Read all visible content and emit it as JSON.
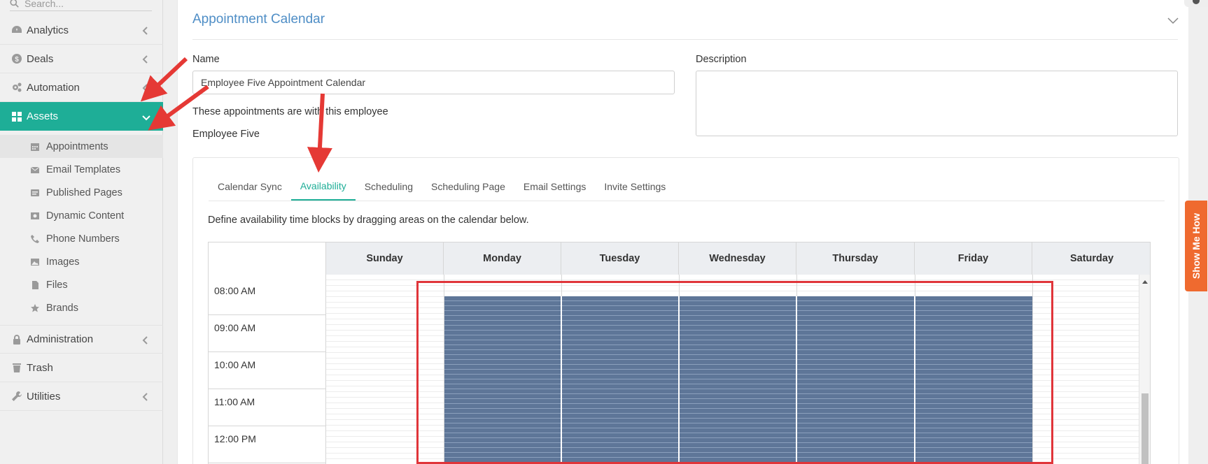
{
  "sidebar": {
    "search_placeholder": "Search...",
    "items": [
      {
        "label": "Analytics",
        "icon": "dashboard-icon"
      },
      {
        "label": "Deals",
        "icon": "dollar-icon"
      },
      {
        "label": "Automation",
        "icon": "cogs-icon"
      },
      {
        "label": "Assets",
        "icon": "grid-icon"
      },
      {
        "label": "Administration",
        "icon": "lock-icon"
      },
      {
        "label": "Trash",
        "icon": "trash-icon"
      },
      {
        "label": "Utilities",
        "icon": "wrench-icon"
      }
    ],
    "assets_submenu": [
      {
        "label": "Appointments",
        "icon": "calendar-icon"
      },
      {
        "label": "Email Templates",
        "icon": "envelope-icon"
      },
      {
        "label": "Published Pages",
        "icon": "page-icon"
      },
      {
        "label": "Dynamic Content",
        "icon": "dynamic-content-icon"
      },
      {
        "label": "Phone Numbers",
        "icon": "phone-icon"
      },
      {
        "label": "Images",
        "icon": "image-icon"
      },
      {
        "label": "Files",
        "icon": "file-icon"
      },
      {
        "label": "Brands",
        "icon": "star-icon"
      }
    ]
  },
  "panel": {
    "title": "Appointment Calendar",
    "name_label": "Name",
    "name_value": "Employee Five Appointment Calendar",
    "description_label": "Description",
    "employee_note": "These appointments are with this employee",
    "employee_name": "Employee Five"
  },
  "tabs": [
    "Calendar Sync",
    "Availability",
    "Scheduling",
    "Scheduling Page",
    "Email Settings",
    "Invite Settings"
  ],
  "active_tab": "Availability",
  "helptext": "Define availability time blocks by dragging areas on the calendar below.",
  "calendar": {
    "days": [
      "Sunday",
      "Monday",
      "Tuesday",
      "Wednesday",
      "Thursday",
      "Friday",
      "Saturday"
    ],
    "times": [
      "08:00 AM",
      "09:00 AM",
      "10:00 AM",
      "11:00 AM",
      "12:00 PM"
    ],
    "available_days": [
      "Monday",
      "Tuesday",
      "Wednesday",
      "Thursday",
      "Friday"
    ],
    "available_start": "08:30 AM",
    "block_color": "#5e7698"
  },
  "show_me_how": "Show Me How",
  "colors": {
    "accent": "#1eae97",
    "title": "#4f8ec6",
    "highlight": "#e0353a",
    "show_me_how": "#ef6a2f"
  }
}
